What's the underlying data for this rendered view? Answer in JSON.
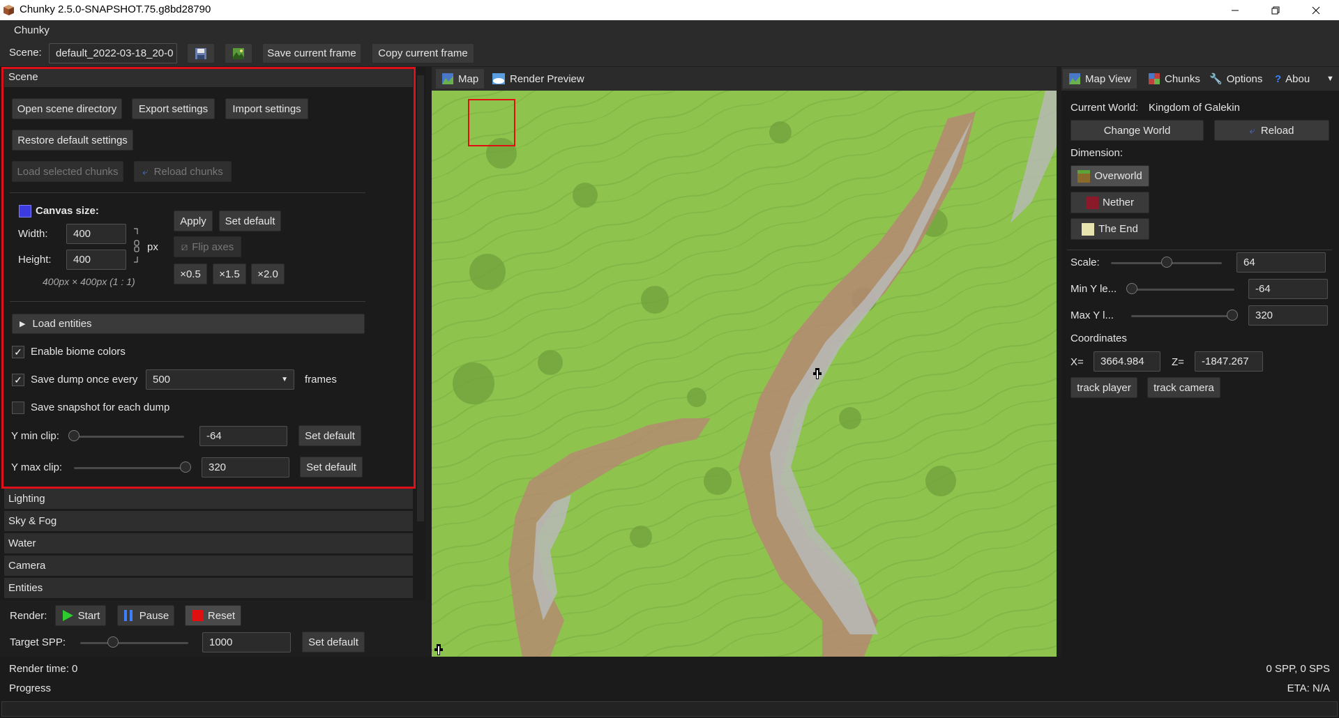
{
  "window": {
    "title": "Chunky 2.5.0-SNAPSHOT.75.g8bd28790",
    "controls": [
      "minimize-icon",
      "restore-icon",
      "close-icon"
    ]
  },
  "menu": {
    "items": [
      "Chunky"
    ]
  },
  "toolbar": {
    "scene_label": "Scene:",
    "scene_name": "default_2022-03-18_20-0",
    "save_frame": "Save current frame",
    "copy_frame": "Copy current frame"
  },
  "left": {
    "scene_header": "Scene",
    "open_dir": "Open scene directory",
    "export": "Export settings",
    "import": "Import settings",
    "restore": "Restore default settings",
    "load_selected": "Load selected chunks",
    "reload_chunks": "Reload chunks",
    "canvas_size": "Canvas size:",
    "width_label": "Width:",
    "width_value": "400",
    "height_label": "Height:",
    "height_value": "400",
    "px": "px",
    "apply": "Apply",
    "set_default": "Set default",
    "flip_axes": "Flip axes",
    "scale_05": "×0.5",
    "scale_15": "×1.5",
    "scale_20": "×2.0",
    "ratio": "400px × 400px (1 : 1)",
    "load_entities": "Load entities",
    "enable_biome": "Enable biome colors",
    "save_dump": "Save dump once every",
    "dump_value": "500",
    "frames": "frames",
    "save_snapshot": "Save snapshot for each dump",
    "ymin_label": "Y min clip:",
    "ymin_value": "-64",
    "ymax_label": "Y max clip:",
    "ymax_value": "320",
    "sections": [
      "Lighting",
      "Sky & Fog",
      "Water",
      "Camera",
      "Entities"
    ],
    "render_label": "Render:",
    "start": "Start",
    "pause": "Pause",
    "reset": "Reset",
    "target_spp_label": "Target SPP:",
    "target_spp_value": "1000"
  },
  "map": {
    "tabs": [
      "Map",
      "Render Preview"
    ]
  },
  "right": {
    "tabs": [
      "Map View",
      "Chunks",
      "Options",
      "Abou"
    ],
    "current_world_label": "Current World:",
    "current_world": "Kingdom of Galekin",
    "change_world": "Change World",
    "reload": "Reload",
    "dimension_label": "Dimension:",
    "dimensions": [
      "Overworld",
      "Nether",
      "The End"
    ],
    "scale_label": "Scale:",
    "scale_value": "64",
    "miny_label": "Min Y le...",
    "miny_value": "-64",
    "maxy_label": "Max Y l...",
    "maxy_value": "320",
    "coordinates_label": "Coordinates",
    "x_label": "X=",
    "x_value": "3664.984",
    "z_label": "Z=",
    "z_value": "-1847.267",
    "track_player": "track player",
    "track_camera": "track camera"
  },
  "status": {
    "render_time": "Render time: 0",
    "spp": "0 SPP, 0 SPS",
    "progress": "Progress",
    "eta": "ETA: N/A"
  },
  "colors": {
    "accent_red": "#e0101a",
    "map_green": "#8ec34e",
    "start_green": "#2ecc2e"
  }
}
